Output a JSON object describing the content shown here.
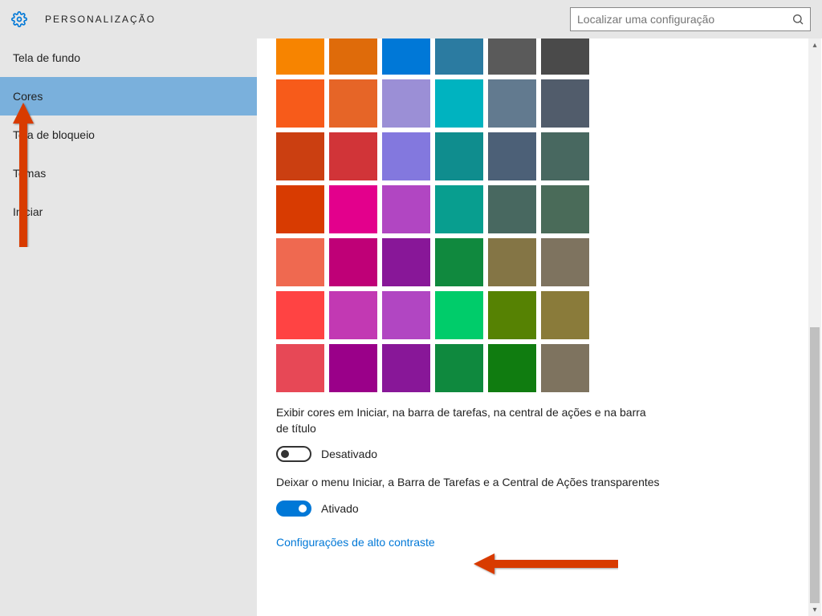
{
  "header": {
    "title": "PERSONALIZAÇÃO",
    "search_placeholder": "Localizar uma configuração"
  },
  "sidebar": {
    "items": [
      {
        "label": "Tela de fundo",
        "selected": false
      },
      {
        "label": "Cores",
        "selected": true
      },
      {
        "label": "Tela de bloqueio",
        "selected": false
      },
      {
        "label": "Temas",
        "selected": false
      },
      {
        "label": "Iniciar",
        "selected": false
      }
    ]
  },
  "colors": {
    "rows": [
      [
        "#f78400",
        "#df6b0a",
        "#0078d7",
        "#2b7ba1",
        "#5a5a5a",
        "#4a4a4a"
      ],
      [
        "#f75b1a",
        "#e66527",
        "#9b8fd6",
        "#00b3c0",
        "#627a8f",
        "#515c6b"
      ],
      [
        "#cb3f11",
        "#d13438",
        "#8378de",
        "#0f8d8e",
        "#4c6077",
        "#486860"
      ],
      [
        "#d83b01",
        "#e3008c",
        "#b146c2",
        "#089e8f",
        "#486860",
        "#4a6b59"
      ],
      [
        "#ef6950",
        "#bf0077",
        "#881798",
        "#10893e",
        "#847545",
        "#7e735f"
      ],
      [
        "#ff4343",
        "#c239b3",
        "#b146c2",
        "#00cc6a",
        "#568203",
        "#8a7b3a"
      ],
      [
        "#e74856",
        "#9a0089",
        "#881798",
        "#0f893e",
        "#107c10",
        "#7e735f"
      ]
    ]
  },
  "settings": {
    "show_color_label": "Exibir cores em Iniciar, na barra de tarefas, na central de ações e na barra de título",
    "show_color_state": "Desativado",
    "transparency_label": "Deixar o menu Iniciar, a Barra de Tarefas e a Central de Ações transparentes",
    "transparency_state": "Ativado",
    "high_contrast_link": "Configurações de alto contraste"
  }
}
